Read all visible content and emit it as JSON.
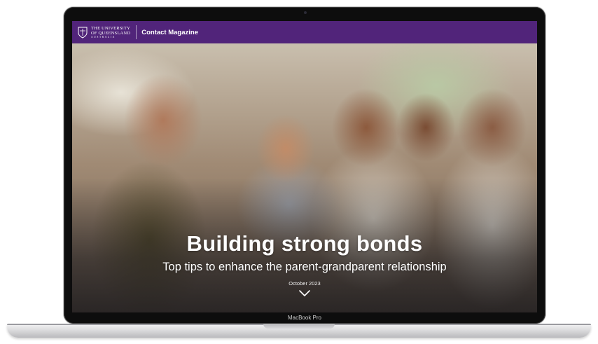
{
  "header": {
    "institution_line1": "THE UNIVERSITY",
    "institution_line2": "OF QUEENSLAND",
    "institution_line3": "AUSTRALIA",
    "site_title": "Contact Magazine",
    "brand_color": "#51247a"
  },
  "hero": {
    "headline": "Building strong bonds",
    "subtitle": "Top tips to enhance the parent-grandparent relationship",
    "date": "October 2023",
    "scroll_icon": "chevron-down-icon"
  },
  "device": {
    "label": "MacBook Pro"
  }
}
